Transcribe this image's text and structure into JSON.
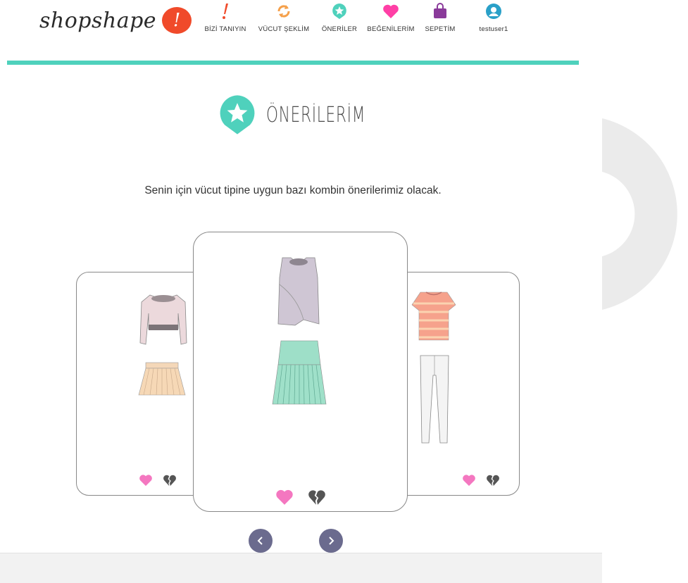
{
  "brand": {
    "name": "shopshape",
    "badge": "!"
  },
  "nav": {
    "items": [
      {
        "label": "BİZİ TANIYIN",
        "icon": "exclamation-icon",
        "color": "#f04a2a"
      },
      {
        "label": "VÜCUT ŞEKLİM",
        "icon": "refresh-icon",
        "color": "#f5a04a"
      },
      {
        "label": "ÖNERİLER",
        "icon": "star-badge-icon",
        "color": "#4fd1bc"
      },
      {
        "label": "BEĞENİLERİM",
        "icon": "heart-icon",
        "color": "#ff3fa6"
      },
      {
        "label": "SEPETİM",
        "icon": "shopping-bag-icon",
        "color": "#8a3a9a"
      },
      {
        "label": "testuser1",
        "icon": "user-icon",
        "color": "#2aa0c8"
      }
    ]
  },
  "page": {
    "title": "ÖNERİLERİM",
    "subtitle": "Senin için vücut tipine uygun bazı kombin önerilerimiz olacak."
  },
  "carousel": {
    "cards": [
      {
        "position": "left",
        "top": "cropped-pink-sweater",
        "bottom": "peach-pleated-mini-skirt"
      },
      {
        "position": "center",
        "top": "lavender-wrap-tank",
        "bottom": "mint-drop-waist-skirt"
      },
      {
        "position": "right",
        "top": "coral-striped-tee",
        "bottom": "white-skinny-pants"
      }
    ]
  },
  "colors": {
    "accent_teal": "#4fd1bc",
    "like_pink": "#f477c0",
    "dislike_gray": "#555555",
    "nav_button": "#6b6b8e"
  }
}
